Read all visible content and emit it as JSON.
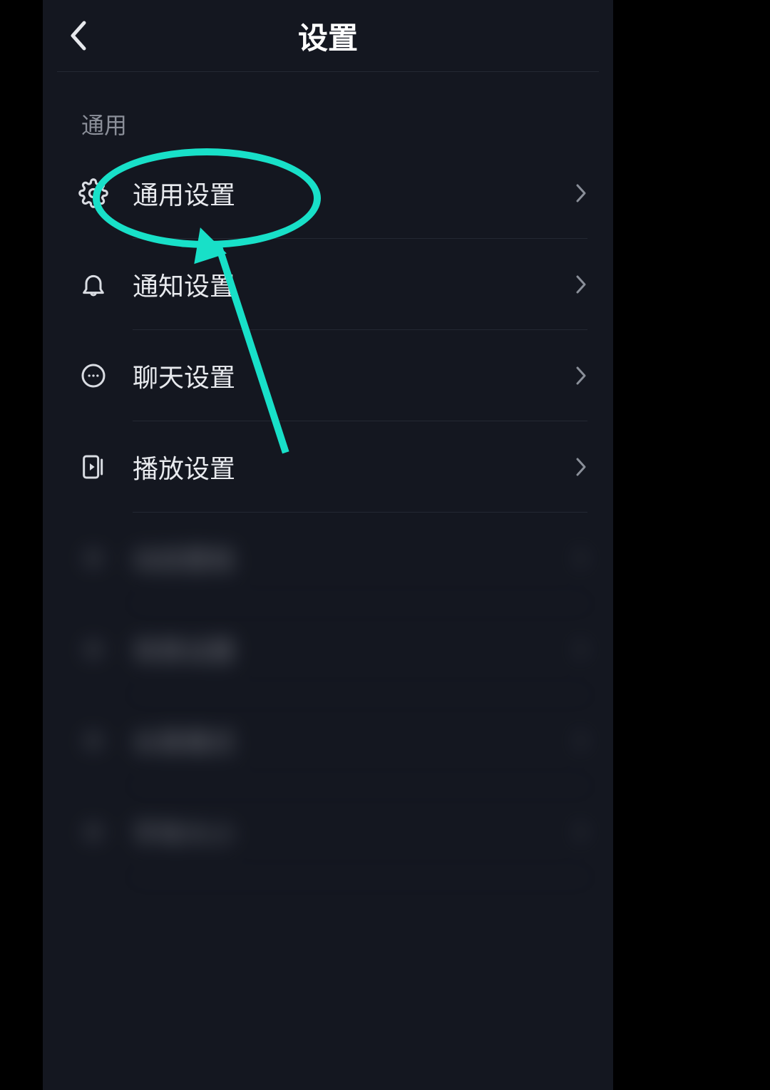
{
  "header": {
    "title": "设置"
  },
  "section": {
    "label": "通用"
  },
  "rows": [
    {
      "icon": "gear-icon",
      "label": "通用设置"
    },
    {
      "icon": "bell-icon",
      "label": "通知设置"
    },
    {
      "icon": "chat-icon",
      "label": "聊天设置"
    },
    {
      "icon": "play-icon",
      "label": "播放设置"
    },
    {
      "icon": "blur-icon",
      "label": "动态壁纸",
      "blurred": true
    },
    {
      "icon": "blur-icon",
      "label": "背景设置",
      "blurred": true
    },
    {
      "icon": "blur-icon",
      "label": "长辈模式",
      "blurred": true
    },
    {
      "icon": "blur-icon",
      "label": "字体大小",
      "blurred": true
    }
  ],
  "annotation": {
    "color": "#18e0c8"
  }
}
